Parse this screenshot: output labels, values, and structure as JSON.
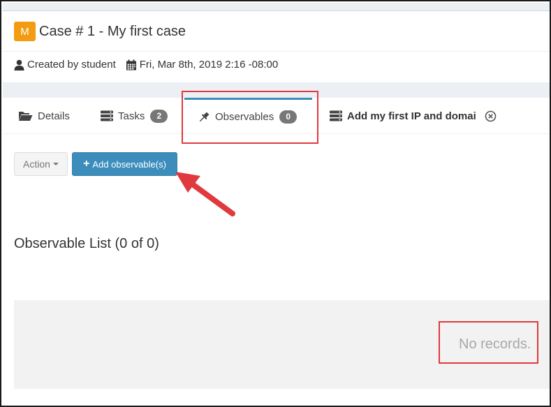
{
  "case": {
    "severity_letter": "M",
    "severity_color": "#f39c12",
    "title": "Case # 1 - My first case",
    "created_by": "Created by student",
    "date": "Fri, Mar 8th, 2019 2:16 -08:00"
  },
  "tabs": [
    {
      "label": "Details",
      "icon": "folder-open-icon"
    },
    {
      "label": "Tasks",
      "icon": "tasks-icon",
      "count": "2"
    },
    {
      "label": "Observables",
      "icon": "pin-icon",
      "count": "0",
      "active": true
    },
    {
      "label": "Add my first IP and domai",
      "icon": "tasks-icon",
      "closable": true
    }
  ],
  "toolbar": {
    "action_label": "Action",
    "add_label": "Add observable(s)"
  },
  "observables": {
    "list_title": "Observable List (0 of 0)",
    "empty_text": "No records."
  },
  "colors": {
    "accent": "#3c8dbc",
    "highlight": "#e0393e",
    "badge": "#777777"
  }
}
